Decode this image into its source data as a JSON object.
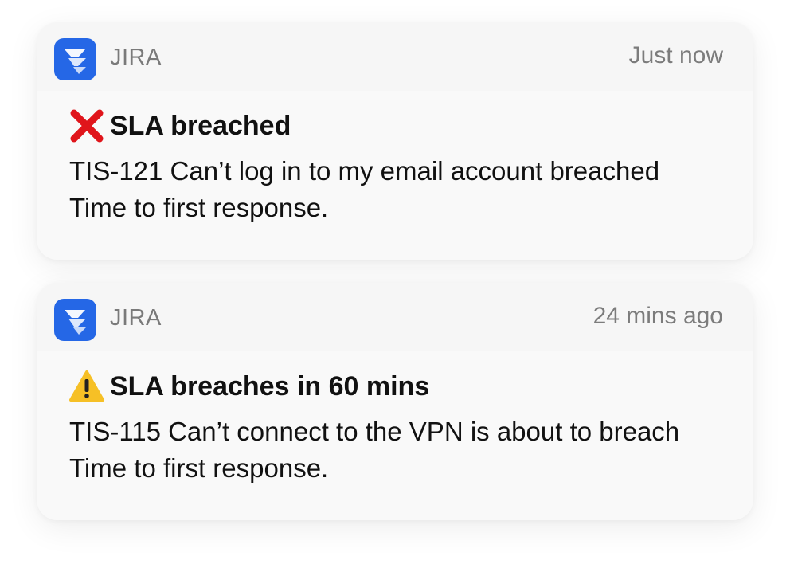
{
  "notifications": [
    {
      "app_name": "JIRA",
      "app_icon": "jira-icon",
      "timestamp": "Just now",
      "status_icon": "cross-mark-icon",
      "title": "SLA breached",
      "message": "TIS-121 Can’t log in to my email account breached Time to first response."
    },
    {
      "app_name": "JIRA",
      "app_icon": "jira-icon",
      "timestamp": "24 mins ago",
      "status_icon": "warning-icon",
      "title": "SLA breaches in 60 mins",
      "message": "TIS-115 Can’t connect to the VPN is about to breach Time to first response."
    }
  ],
  "colors": {
    "jira_blue": "#2567e6",
    "error_red": "#e0151b",
    "warning_yellow": "#f6c026"
  }
}
